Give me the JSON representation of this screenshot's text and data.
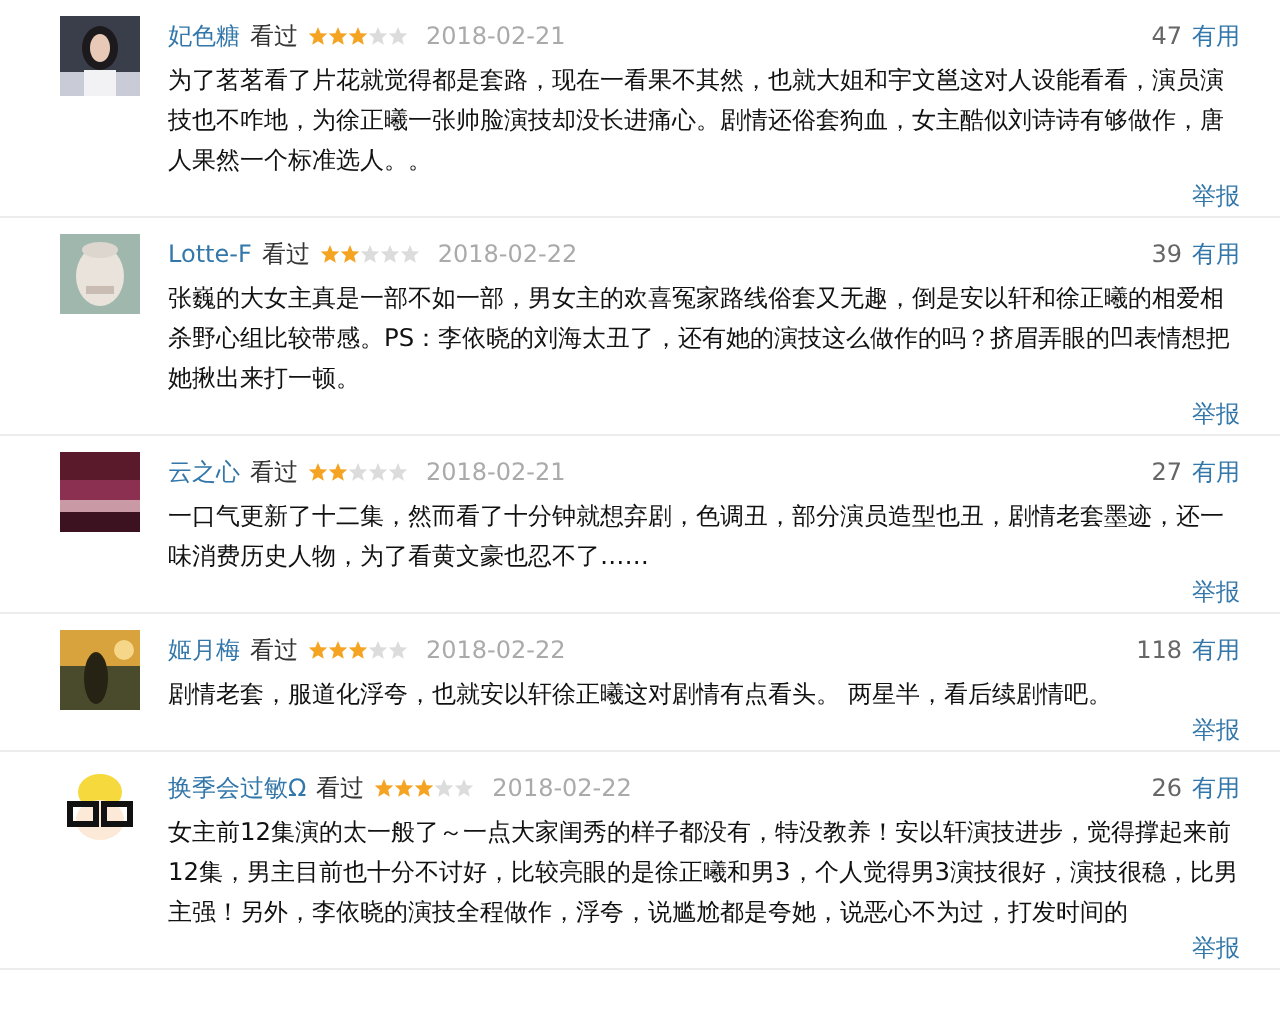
{
  "reviews": [
    {
      "user": "妃色糖",
      "status": "看过",
      "stars": 3,
      "date": "2018-02-21",
      "votes": "47",
      "useful": "有用",
      "text": "为了茗茗看了片花就觉得都是套路，现在一看果不其然，也就大姐和宇文邕这对人设能看看，演员演技也不咋地，为徐正曦一张帅脸演技却没长进痛心。剧情还俗套狗血，女主酷似刘诗诗有够做作，唐人果然一个标准选人。。",
      "report": "举报"
    },
    {
      "user": "Lotte-F",
      "status": "看过",
      "stars": 2,
      "date": "2018-02-22",
      "votes": "39",
      "useful": "有用",
      "text": "张巍的大女主真是一部不如一部，男女主的欢喜冤家路线俗套又无趣，倒是安以轩和徐正曦的相爱相杀野心组比较带感。PS：李依晓的刘海太丑了，还有她的演技这么做作的吗？挤眉弄眼的凹表情想把她揪出来打一顿。",
      "report": "举报"
    },
    {
      "user": "云之心",
      "status": "看过",
      "stars": 2,
      "date": "2018-02-21",
      "votes": "27",
      "useful": "有用",
      "text": "一口气更新了十二集，然而看了十分钟就想弃剧，色调丑，部分演员造型也丑，剧情老套墨迹，还一味消费历史人物，为了看黄文豪也忍不了……",
      "report": "举报"
    },
    {
      "user": "姬月梅",
      "status": "看过",
      "stars": 3,
      "date": "2018-02-22",
      "votes": "118",
      "useful": "有用",
      "text": "剧情老套，服道化浮夸，也就安以轩徐正曦这对剧情有点看头。 两星半，看后续剧情吧。",
      "report": "举报"
    },
    {
      "user": "换季会过敏Ω",
      "status": "看过",
      "stars": 3,
      "date": "2018-02-22",
      "votes": "26",
      "useful": "有用",
      "text": "女主前12集演的太一般了～一点大家闺秀的样子都没有，特没教养！安以轩演技进步，觉得撑起来前12集，男主目前也十分不讨好，比较亮眼的是徐正曦和男3，个人觉得男3演技很好，演技很稳，比男主强！另外，李依晓的演技全程做作，浮夸，说尴尬都是夸她，说恶心不为过，打发时间的",
      "report": "举报"
    }
  ]
}
